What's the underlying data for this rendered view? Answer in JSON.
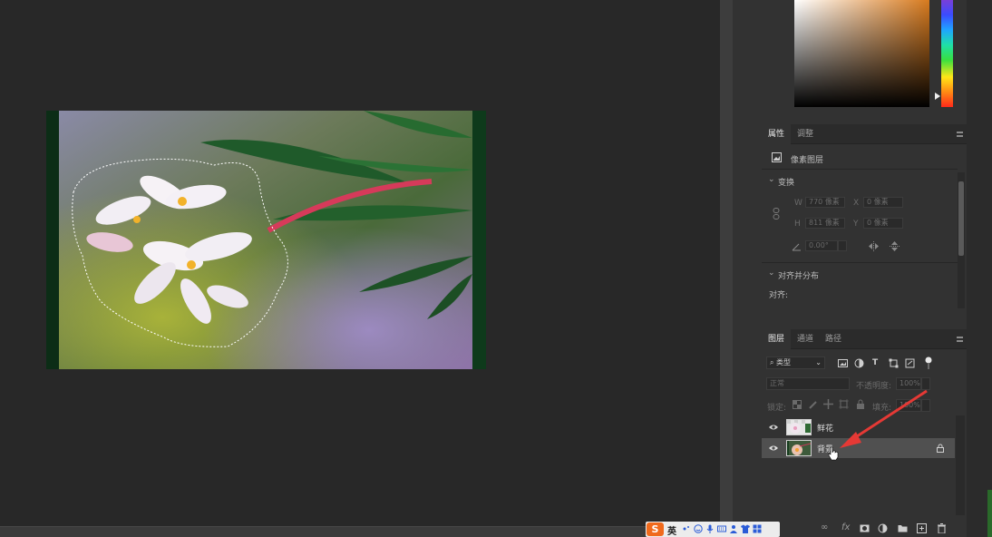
{
  "properties_panel": {
    "tabs": [
      "属性",
      "调整"
    ],
    "layer_type": "像素图层",
    "transform_header": "变换",
    "w_label": "W",
    "w_value": "770 像素",
    "h_label": "H",
    "h_value": "811 像素",
    "x_label": "X",
    "x_value": "0 像素",
    "y_label": "Y",
    "y_value": "0 像素",
    "angle_value": "0.00°",
    "align_header": "对齐并分布",
    "align_label": "对齐:"
  },
  "layers_panel": {
    "tabs": [
      "图层",
      "通道",
      "路径"
    ],
    "filter_label": "类型",
    "blend_mode": "正常",
    "opacity_label": "不透明度:",
    "opacity_value": "100%",
    "lock_label": "锁定:",
    "fill_label": "填充:",
    "fill_value": "100%",
    "layers": [
      {
        "name": "鲜花",
        "visible": true,
        "selected": false,
        "locked": false
      },
      {
        "name": "背景",
        "visible": true,
        "selected": true,
        "locked": true
      }
    ],
    "footer_icons": [
      "link-icon",
      "fx-icon",
      "mask-icon",
      "adjustment-icon",
      "group-folder-icon",
      "new-layer-icon",
      "trash-icon"
    ]
  },
  "ime": {
    "mode_text": "英",
    "logo": "S"
  },
  "colors": {
    "annotation_arrow": "#e53935",
    "accent_ime": "#f06a1c"
  }
}
